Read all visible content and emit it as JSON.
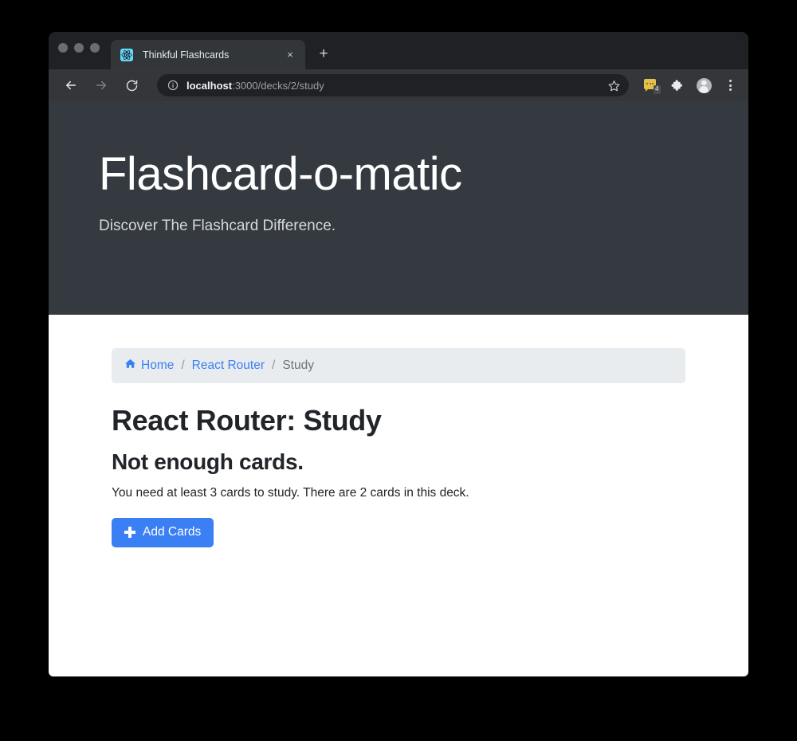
{
  "browser": {
    "tab": {
      "title": "Thinkful Flashcards",
      "favicon_name": "react-logo-favicon",
      "close_label": "×"
    },
    "new_tab_label": "+",
    "nav": {
      "back_label": "←",
      "forward_label": "→",
      "reload_label": "↻"
    },
    "omnibox": {
      "info_icon": "site-info-icon",
      "url_host": "localhost",
      "url_path": ":3000/decks/2/study",
      "star_icon": "bookmark-star-icon"
    },
    "toolbar_icons": {
      "notifications_badge": "4",
      "extensions_icon": "puzzle-piece-icon",
      "profile_icon": "avatar-icon",
      "menu_icon": "kebab-menu-icon"
    }
  },
  "page": {
    "jumbotron": {
      "title": "Flashcard-o-matic",
      "subtitle": "Discover The Flashcard Difference."
    },
    "breadcrumb": {
      "home_icon": "home-icon",
      "items": [
        {
          "label": "Home",
          "active": false
        },
        {
          "label": "React Router",
          "active": false
        },
        {
          "label": "Study",
          "active": true
        }
      ],
      "separator": "/"
    },
    "title": "React Router: Study",
    "section_heading": "Not enough cards.",
    "body": "You need at least 3 cards to study. There are 2 cards in this deck.",
    "add_cards_button": "Add Cards"
  },
  "colors": {
    "accent_blue": "#3b7ff5",
    "jumbotron_bg": "#343a40",
    "breadcrumb_bg": "#e9ecef",
    "notification_yellow": "#e5c04a"
  }
}
